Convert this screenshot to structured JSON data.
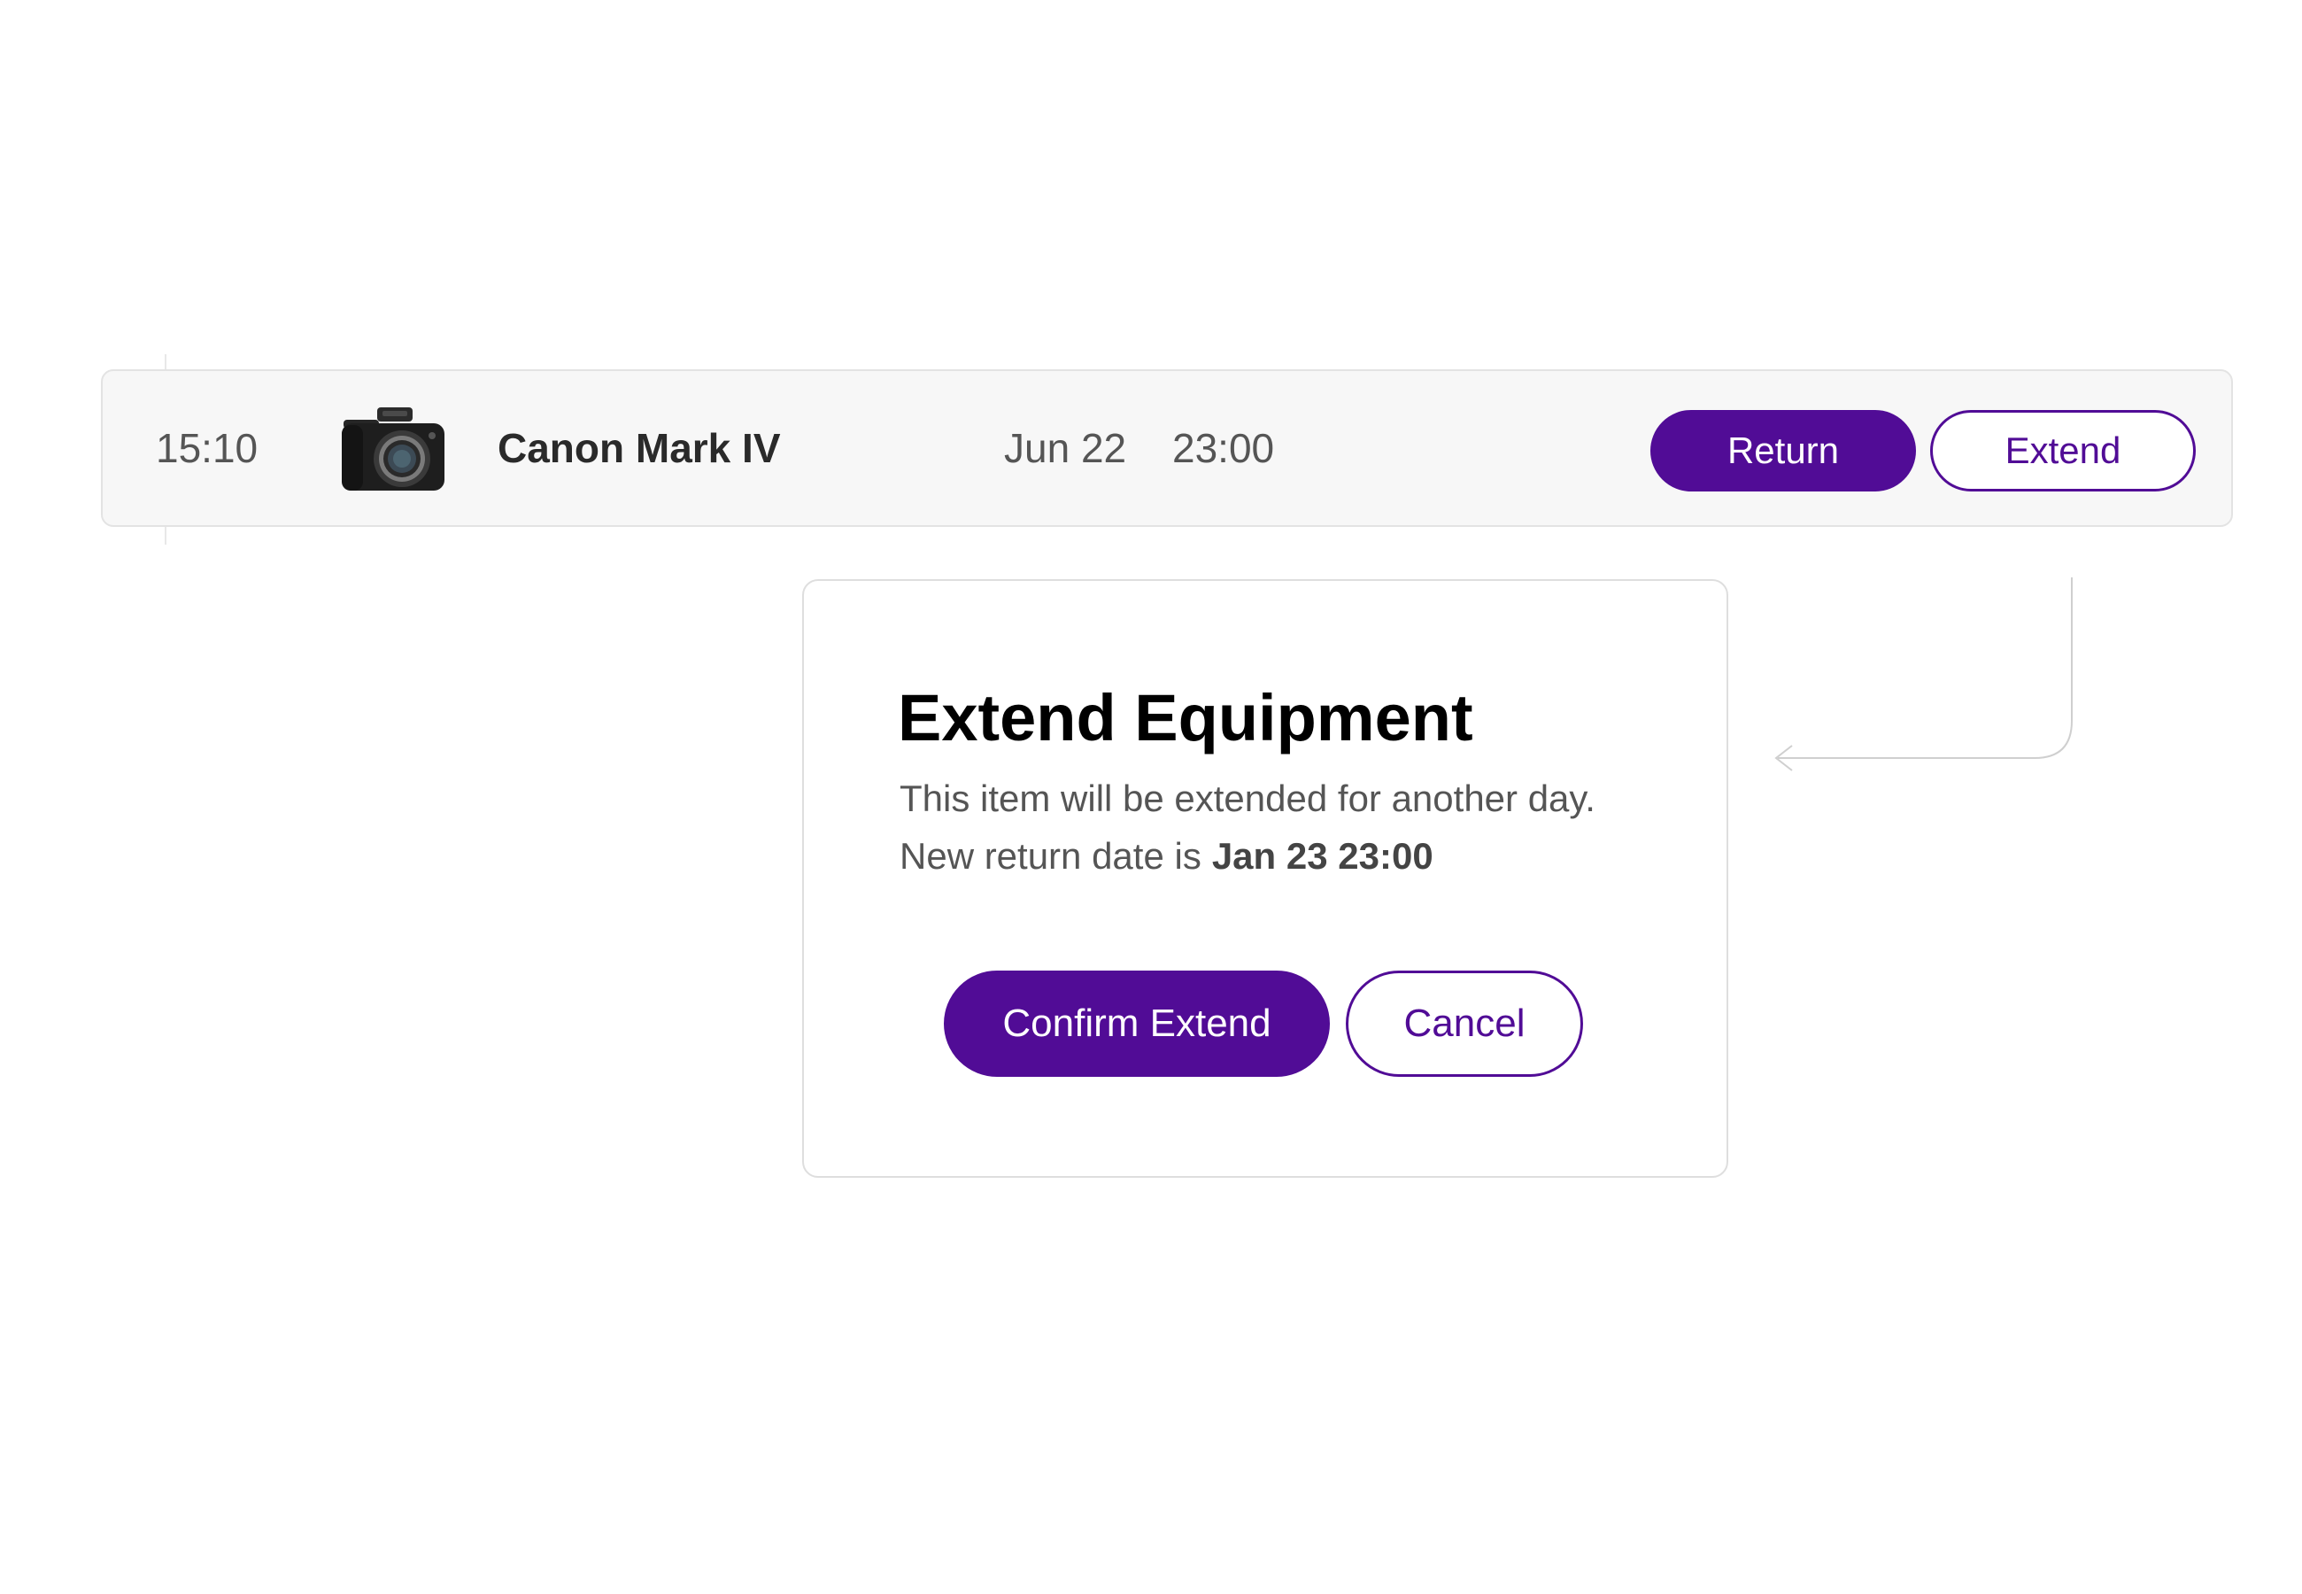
{
  "equipment_row": {
    "time": "15:10",
    "item_name": "Canon Mark IV",
    "due_date": "Jun 22",
    "due_time": "23:00",
    "return_label": "Return",
    "extend_label": "Extend",
    "icon": "camera-icon"
  },
  "modal": {
    "title": "Extend Equipment",
    "description": "This item will be extended for another day.",
    "new_date_prefix": "New return date is",
    "new_date_value": "Jan 23 23:00",
    "confirm_label": "Confirm Extend",
    "cancel_label": "Cancel"
  },
  "colors": {
    "accent": "#510c96",
    "row_background": "#f7f7f7",
    "text_muted": "#555555"
  }
}
